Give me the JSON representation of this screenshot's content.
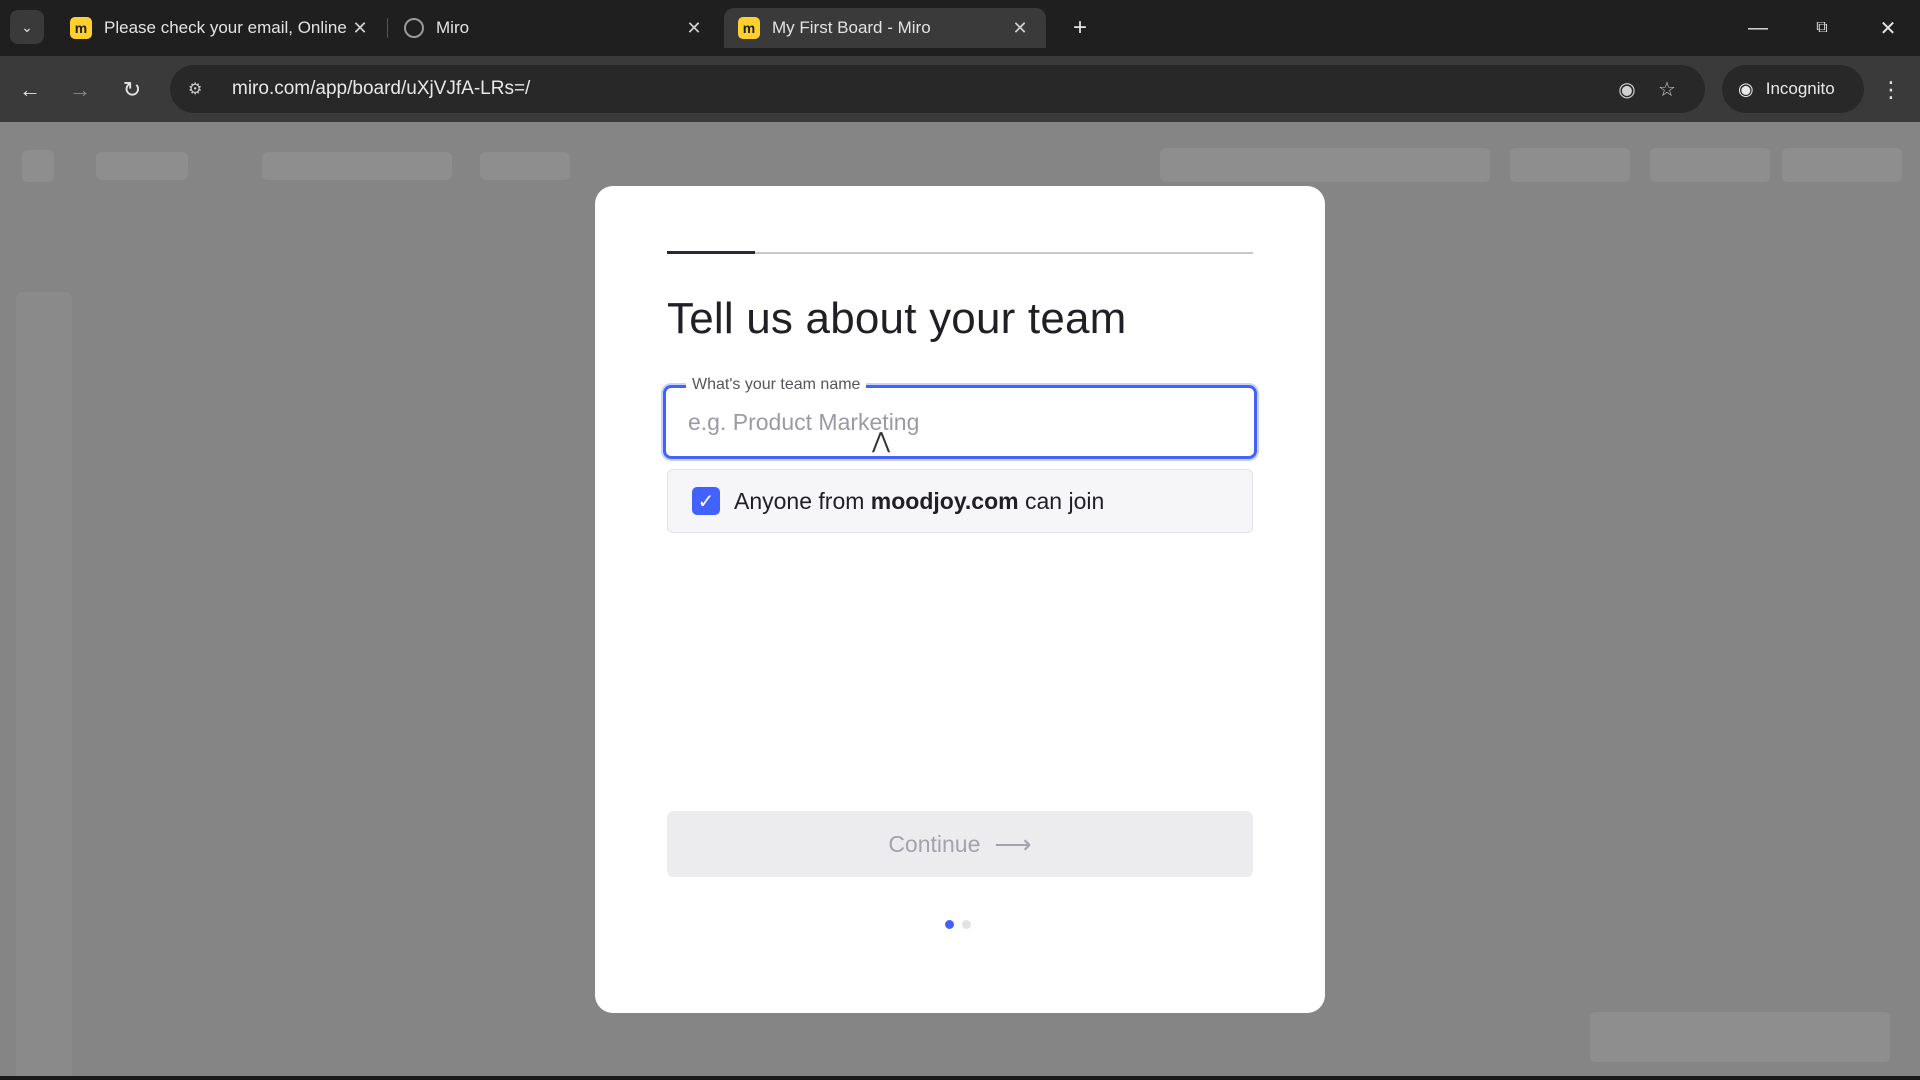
{
  "browser": {
    "tabs": [
      {
        "title": "Please check your email, Online",
        "favicon": "miro-logo-icon",
        "active": false
      },
      {
        "title": "Miro",
        "favicon": "globe-icon",
        "active": false
      },
      {
        "title": "My First Board - Miro",
        "favicon": "miro-logo-icon",
        "active": true
      }
    ],
    "url": "miro.com/app/board/uXjVJfA-LRs=/",
    "incognito_label": "Incognito"
  },
  "modal": {
    "progress_fraction": 0.15,
    "heading": "Tell us about your team",
    "team_name_label": "What's your team name",
    "team_name_placeholder": "e.g. Product Marketing",
    "team_name_value": "",
    "join_prefix": "Anyone from",
    "join_domain": "moodjoy.com",
    "join_suffix": "can join",
    "join_checked": true,
    "continue_label": "Continue",
    "step_current": 1,
    "step_total": 2
  },
  "colors": {
    "accent": "#4262ff",
    "overlay": "#858585",
    "miro_yellow": "#ffd02f"
  }
}
